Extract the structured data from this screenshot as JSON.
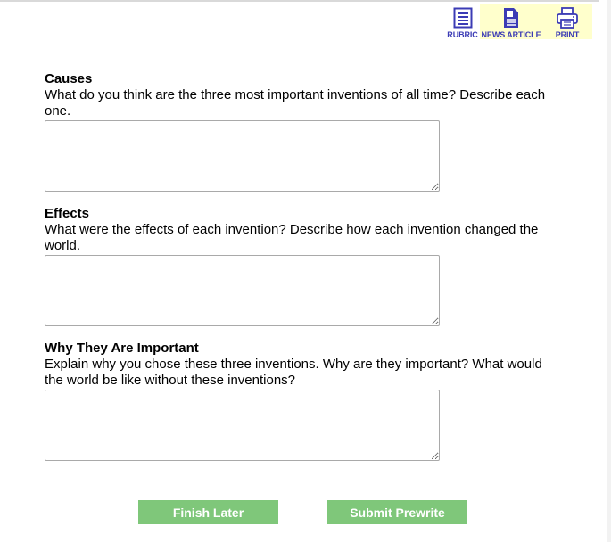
{
  "toolbar": {
    "rubric_label": "RUBRIC",
    "news_label": "NEWS ARTICLE",
    "print_label": "PRINT"
  },
  "sections": [
    {
      "heading": "Causes",
      "prompt": "What do you think are the three most important inventions of all time? Describe each one.",
      "value": ""
    },
    {
      "heading": "Effects",
      "prompt": "What were the effects of each invention? Describe how each invention changed the world.",
      "value": ""
    },
    {
      "heading": "Why They Are Important",
      "prompt": "Explain why you chose these three inventions. Why are they important? What would the world be like without these inventions?",
      "value": ""
    }
  ],
  "buttons": {
    "finish_later": "Finish Later",
    "submit_prewrite": "Submit Prewrite"
  },
  "colors": {
    "toolbar_bg": "#ffffcc",
    "icon_blue": "#3b3bb5",
    "button_green": "#7fc77a"
  }
}
